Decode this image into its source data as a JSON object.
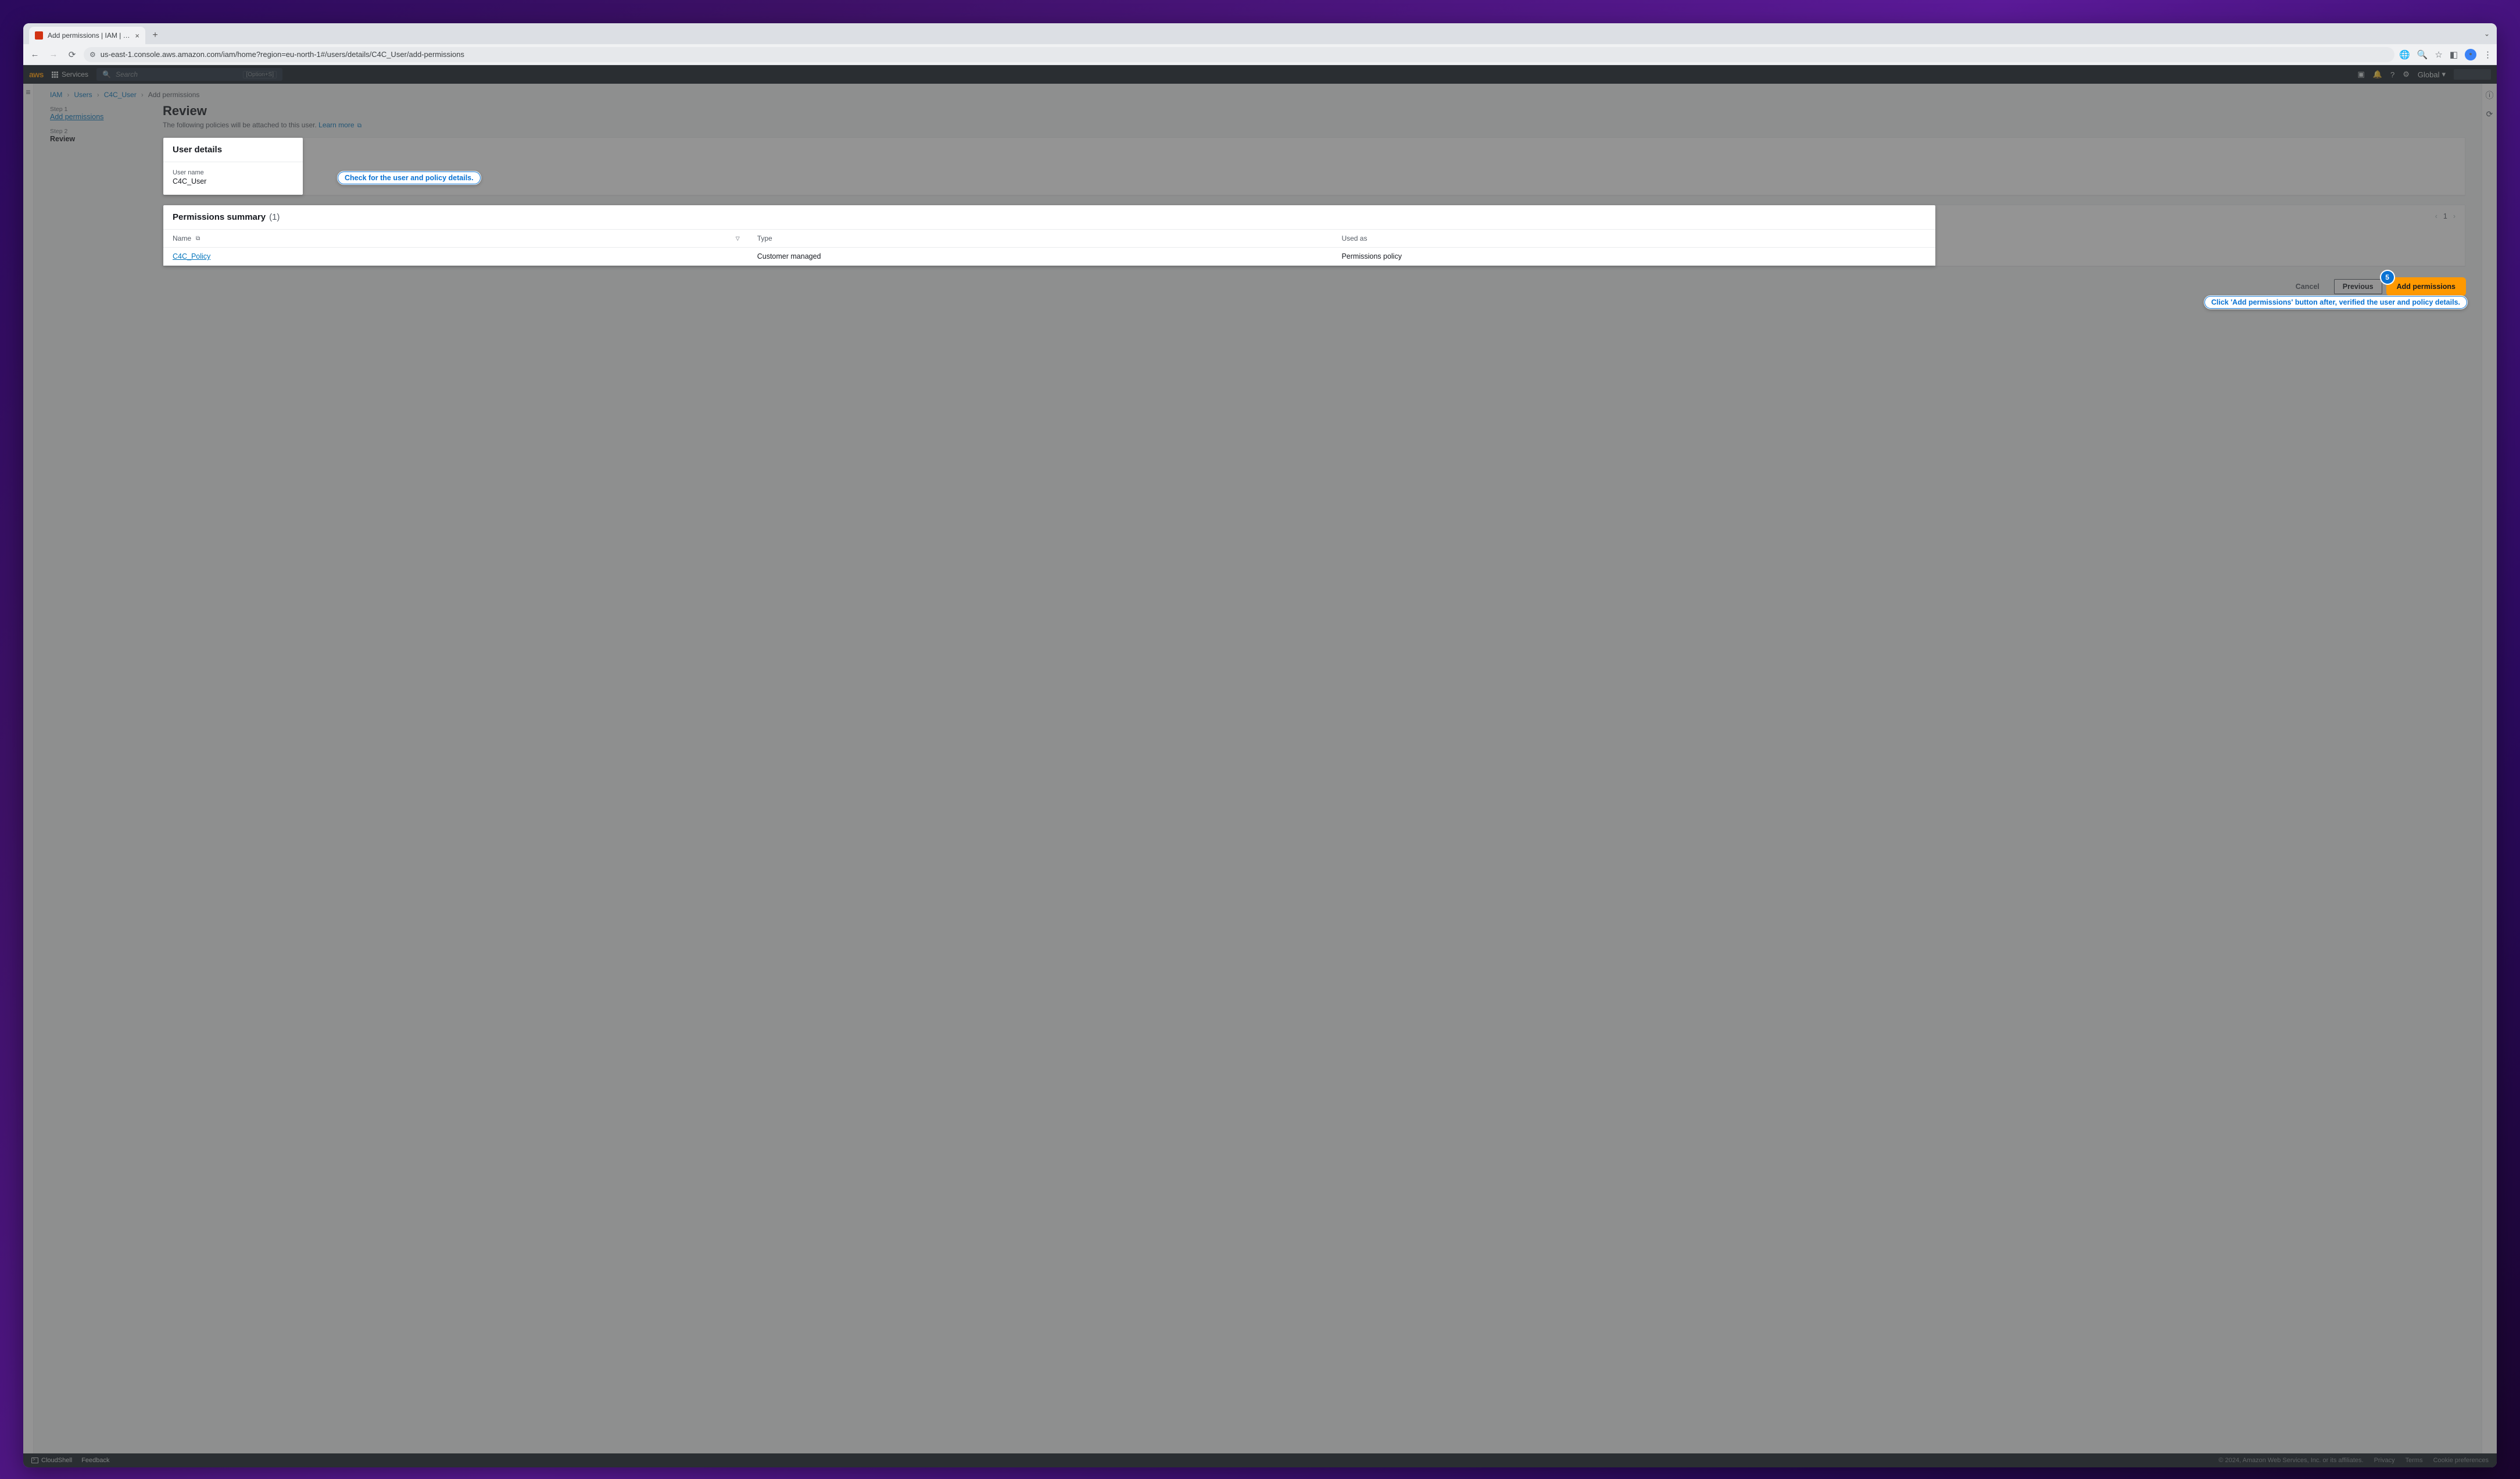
{
  "browser": {
    "tab_title": "Add permissions | IAM | Glob",
    "url": "us-east-1.console.aws.amazon.com/iam/home?region=eu-north-1#/users/details/C4C_User/add-permissions"
  },
  "aws_top": {
    "services_label": "Services",
    "search_placeholder": "Search",
    "search_kbd": "[Option+S]",
    "region": "Global"
  },
  "breadcrumbs": {
    "iam": "IAM",
    "users": "Users",
    "user": "C4C_User",
    "current": "Add permissions"
  },
  "steps": {
    "s1_label": "Step 1",
    "s1_name": "Add permissions",
    "s2_label": "Step 2",
    "s2_name": "Review"
  },
  "page": {
    "title": "Review",
    "desc_text": "The following policies will be attached to this user. ",
    "learn_more": "Learn more"
  },
  "user_details": {
    "panel_title": "User details",
    "name_label": "User name",
    "name_value": "C4C_User"
  },
  "perm_summary": {
    "panel_title": "Permissions summary",
    "count": "(1)",
    "col_name": "Name",
    "col_type": "Type",
    "col_used": "Used as",
    "page_num": "1",
    "rows": [
      {
        "name": "C4C_Policy",
        "type": "Customer managed",
        "used": "Permissions policy"
      }
    ]
  },
  "actions": {
    "cancel": "Cancel",
    "previous": "Previous",
    "add": "Add permissions"
  },
  "callouts": {
    "c1": "Check for the user and policy details.",
    "c2": "Click 'Add permissions' button after, verified the user and policy details.",
    "badge": "5"
  },
  "footer": {
    "cloudshell": "CloudShell",
    "feedback": "Feedback",
    "copyright": "© 2024, Amazon Web Services, Inc. or its affiliates.",
    "privacy": "Privacy",
    "terms": "Terms",
    "cookies": "Cookie preferences"
  }
}
